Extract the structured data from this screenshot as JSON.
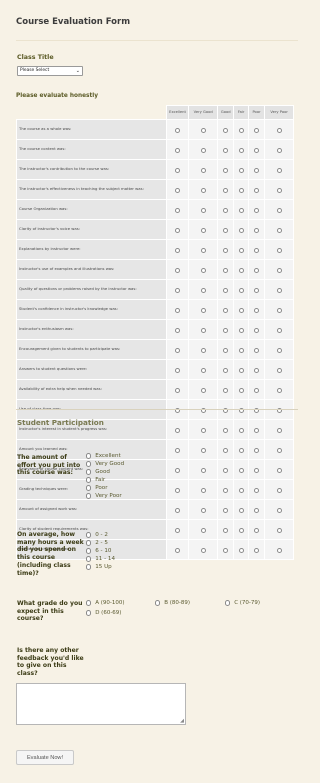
{
  "form": {
    "title": "Course Evaluation Form"
  },
  "class_title": {
    "label": "Class Title",
    "selected": "Please Select"
  },
  "matrix": {
    "label": "Please evaluate honestly",
    "columns": [
      "Excellent",
      "Very Good",
      "Good",
      "Fair",
      "Poor",
      "Very Poor"
    ],
    "rows": [
      "The course as a whole was:",
      "The course content was:",
      "The instructor's contribution to the course was:",
      "The instructor's effectiveness in teaching the subject matter was:",
      "Course Organization was:",
      "Clarity of instructor's voice was:",
      "Explanations by instructor were:",
      "Instructor's use of examples and illustrations was:",
      "Quality of questions or problems raised by the instructor was:",
      "Student's confidence in instructor's knowledge was:",
      "Instructor's enthusiasm was:",
      "Encouragement given to students to participate was:",
      "Answers to student questions were:",
      "Availability of extra help when needed was:",
      "Use of class time was:",
      "Instructor's interest in student's progress was:",
      "Amount you learned was:",
      "Relevance of course content was:",
      "Grading techniques were:",
      "Amount of assigned work was:",
      "Clarity of student requirements was:",
      "Intellectual challenge was:"
    ]
  },
  "participation": {
    "title": "Student Participation",
    "effort": {
      "label": "The amount of effort you put into this course was:",
      "options": [
        "Excellent",
        "Very Good",
        "Good",
        "Fair",
        "Poor",
        "Very Poor"
      ]
    },
    "hours": {
      "label": "On average, how many hours a week did you spend on this course (including class time)?",
      "options": [
        "0 - 2",
        "2 - 5",
        "6 - 10",
        "11 - 14",
        "15 Up"
      ]
    },
    "grade": {
      "label": "What grade do you expect in this course?",
      "options": [
        "A (90-100)",
        "B (80-89)",
        "C (70-79)",
        "D (60-69)"
      ]
    },
    "feedback": {
      "label": "Is there any other feedback you'd like to give on this class?",
      "value": ""
    }
  },
  "submit": {
    "label": "Evaluate Now!"
  }
}
